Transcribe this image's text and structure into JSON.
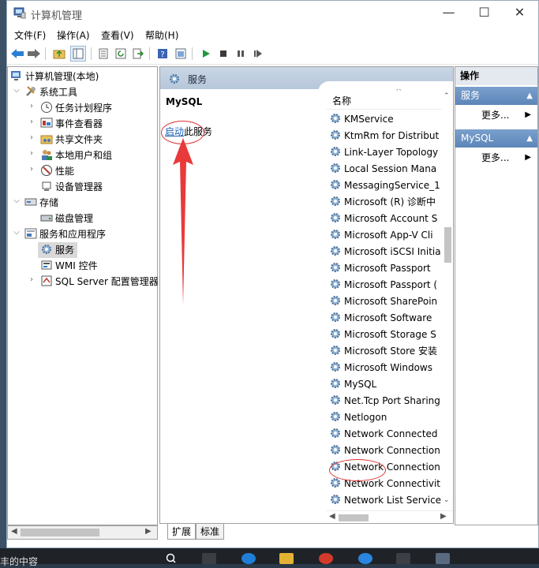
{
  "window": {
    "title": "计算机管理",
    "controls": {
      "minimize": "—",
      "maximize": "☐",
      "close": "✕"
    }
  },
  "menubar": [
    "文件(F)",
    "操作(A)",
    "查看(V)",
    "帮助(H)"
  ],
  "toolbar_icons": [
    "back-icon",
    "forward-icon",
    "up-folder-icon",
    "show-tree-icon",
    "properties-icon",
    "refresh-icon",
    "export-icon",
    "help-icon",
    "view-icon",
    "start-service-icon",
    "stop-service-icon",
    "pause-service-icon",
    "restart-service-icon"
  ],
  "tree": {
    "root": "计算机管理(本地)",
    "system_tools": "系统工具",
    "system_children": [
      "任务计划程序",
      "事件查看器",
      "共享文件夹",
      "本地用户和组",
      "性能",
      "设备管理器"
    ],
    "storage": "存储",
    "storage_children": [
      "磁盘管理"
    ],
    "services_apps": "服务和应用程序",
    "services_children": [
      "服务",
      "WMI 控件",
      "SQL Server 配置管理器"
    ]
  },
  "middle": {
    "header": "服务",
    "selected_service": "MySQL",
    "start_link": "启动",
    "start_suffix": "此服务",
    "column_name": "名称",
    "services": [
      "KMService",
      "KtmRm for Distribut",
      "Link-Layer Topology",
      "Local Session Mana",
      "MessagingService_1",
      "Microsoft (R) 诊断中",
      "Microsoft Account S",
      "Microsoft App-V Cli",
      "Microsoft iSCSI Initia",
      "Microsoft Passport",
      "Microsoft Passport (",
      "Microsoft SharePoin",
      "Microsoft Software",
      "Microsoft Storage S",
      "Microsoft Store 安装",
      "Microsoft Windows",
      "MySQL",
      "Net.Tcp Port Sharing",
      "Netlogon",
      "Network Connected",
      "Network Connection",
      "Network Connection",
      "Network Connectivit",
      "Network List Service"
    ],
    "tabs": [
      "扩展",
      "标准"
    ]
  },
  "actions": {
    "title": "操作",
    "sections": [
      {
        "label": "服务",
        "more": "更多..."
      },
      {
        "label": "MySQL",
        "more": "更多..."
      }
    ]
  },
  "background": {
    "taskbar_text": "丰的中容"
  },
  "colors": {
    "accent_link": "#1a5fb4",
    "annotation_red": "#e03030",
    "section_blue": "#5c85b8"
  }
}
